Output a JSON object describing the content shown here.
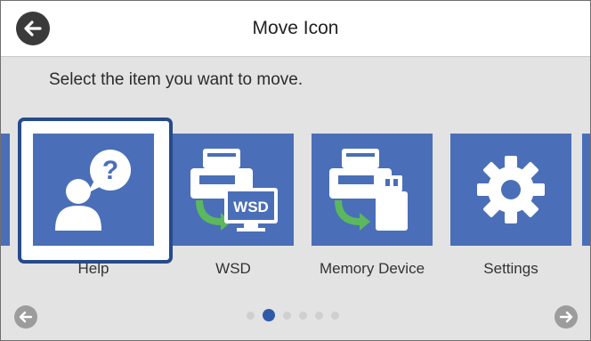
{
  "header": {
    "title": "Move Icon",
    "back_icon": "arrow-left-icon"
  },
  "instruction": "Select the item you want to move.",
  "tiles": [
    {
      "label": "Help",
      "icon": "help-person-icon",
      "selected": true
    },
    {
      "label": "WSD",
      "icon": "wsd-scanner-icon",
      "selected": false
    },
    {
      "label": "Memory Device",
      "icon": "memory-device-scanner-icon",
      "selected": false
    },
    {
      "label": "Settings",
      "icon": "gear-icon",
      "selected": false
    }
  ],
  "pagination": {
    "total": 6,
    "current": 2
  },
  "colors": {
    "tile": "#4a6fb8",
    "selected_border": "#274a8c",
    "active_dot": "#2f5aa8",
    "background": "#e3e3e3"
  }
}
